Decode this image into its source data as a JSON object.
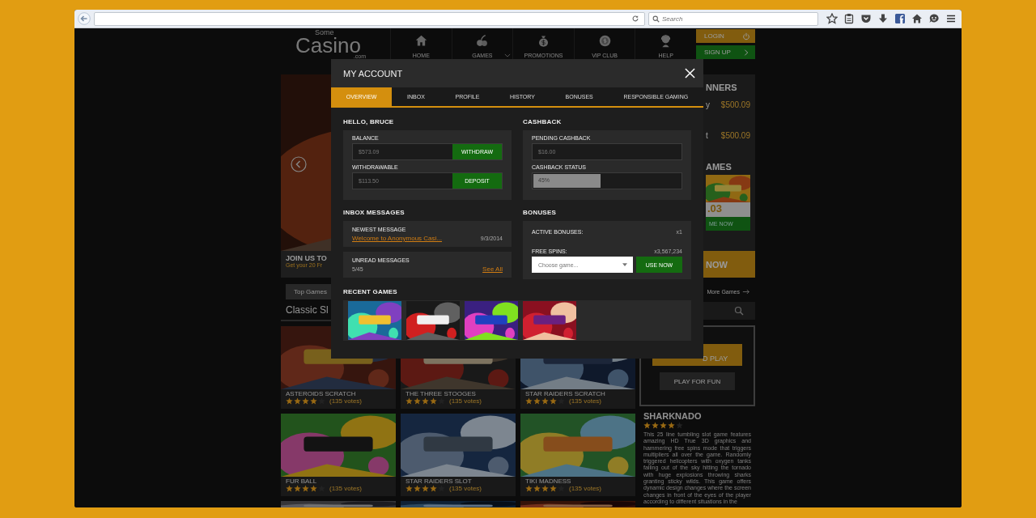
{
  "browser": {
    "search": {
      "placeholder": "Search"
    }
  },
  "site": {
    "logo": {
      "small": "Some",
      "main": "Casino",
      "suffix": ".com"
    },
    "nav": [
      {
        "label": "HOME",
        "has_menu": false
      },
      {
        "label": "GAMES",
        "has_menu": true
      },
      {
        "label": "PROMOTIONS",
        "has_menu": false
      },
      {
        "label": "VIP CLUB",
        "has_menu": false
      },
      {
        "label": "HELP",
        "has_menu": false
      }
    ],
    "account": [
      {
        "label": "LOGIN",
        "kind": "login"
      },
      {
        "label": "SIGN UP",
        "kind": "signup"
      }
    ],
    "hero": {
      "title": "JOIN US TO",
      "subtitle": "Get your 20 Fr"
    },
    "filter_tab": "Top Games",
    "section_title": "Classic Sl",
    "games": [
      {
        "title": "ASTEROIDS SCRATCH",
        "stars": 4,
        "votes": "(135 votes)"
      },
      {
        "title": "THE THREE STOOGES",
        "stars": 4,
        "votes": "(135 votes)"
      },
      {
        "title": "STAR RAIDERS SCRATCH",
        "stars": 4,
        "votes": "(135 votes)"
      },
      {
        "title": "FUR BALL",
        "stars": 4,
        "votes": "(135 votes)"
      },
      {
        "title": "STAR RAIDERS SLOT",
        "stars": 4,
        "votes": "(135 votes)"
      },
      {
        "title": "TIKI MADNESS",
        "stars": 4,
        "votes": "(135 votes)"
      }
    ],
    "winners": {
      "title": "NNERS",
      "rows": [
        {
          "name": "y",
          "amount": "$500.09"
        },
        {
          "name": "t",
          "amount": "$500.09"
        }
      ]
    },
    "top_games": {
      "title": "AMES",
      "jackpot": ".03",
      "button": "ME NOW"
    },
    "cta": "NOW",
    "more_games": "More Games",
    "featured": {
      "primary_button": "D PLAY",
      "secondary_button": "PLAY FOR FUN",
      "title": "SHARKNADO",
      "stars": 4,
      "description": "This 25 line tumbling slot game features amazing HD True 3D graphics and hammering free spins mode that triggers multipliers all over the game. Randomly triggered helicopters  with oxygen tanks falling out of the sky hitting the  tornado with huge explosions  throwing sharks granting sticky wilds. This game offers dynamic design changes where the screen changes in front of the eyes of the player according to different situations in the"
    }
  },
  "modal": {
    "title": "MY ACCOUNT",
    "tabs": [
      {
        "label": "OVERVIEW",
        "selected": true
      },
      {
        "label": "INBOX",
        "selected": false
      },
      {
        "label": "PROFILE",
        "selected": false
      },
      {
        "label": "HISTORY",
        "selected": false
      },
      {
        "label": "BONUSES",
        "selected": false
      },
      {
        "label": "RESPONSIBLE GAMING",
        "selected": false
      }
    ],
    "balance": {
      "heading": "HELLO, BRUCE",
      "fields": [
        {
          "label": "BALANCE",
          "value": "$573.09",
          "button": "WITHDRAW"
        },
        {
          "label": "WITHDRAWABLE",
          "value": "$113.50",
          "button": "DEPOSIT"
        }
      ]
    },
    "cashback": {
      "heading": "CASHBACK",
      "pending_label": "PENDING CASHBACK",
      "pending_value": "$16.00",
      "status_label": "CASHBACK STATUS",
      "status": {
        "level": 0.45,
        "reading": "45%"
      }
    },
    "inbox": {
      "heading": "INBOX MESSAGES",
      "newest_label": "NEWEST MESSAGE",
      "newest_link": "Welcome to Anonymous Casi...",
      "newest_date": "9/3/2014",
      "unread_label": "UNREAD MESSAGES",
      "unread_count": "5/45",
      "see_all": "See All"
    },
    "bonuses": {
      "heading": "BONUSES",
      "active_label": "ACTIVE BONUSES:",
      "active_count": "x1",
      "spins_label": "FREE SPINS:",
      "spins_count": "x3,567,234",
      "select": {
        "placeholder": "Choose game..."
      },
      "button": "USE NOW"
    },
    "recent": {
      "heading": "RECENT GAMES"
    }
  }
}
